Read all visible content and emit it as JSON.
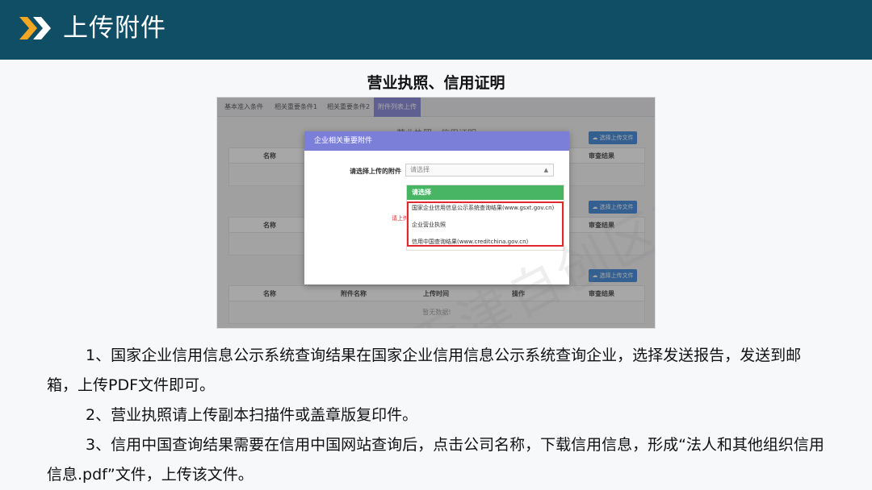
{
  "header": {
    "title": "上传附件"
  },
  "section_heading": "营业执照、信用证明",
  "screenshot": {
    "tabs": [
      {
        "label": "基本准入条件",
        "active": false
      },
      {
        "label": "相关重要条件1",
        "active": false
      },
      {
        "label": "相关重要条件2",
        "active": false
      },
      {
        "label": "附件列表上传",
        "active": true
      }
    ],
    "bg_title": "营业执照、信用证明",
    "upload_button_label": "选择上传文件",
    "columns": [
      "名称",
      "附件名称",
      "上传时间",
      "操作",
      "审查结果"
    ],
    "empty_text": "暂无数据!",
    "modal": {
      "title": "企业相关重要附件",
      "field_label": "请选择上传的附件",
      "select_placeholder": "请选择",
      "error_text": "请上传",
      "dropdown_header": "请选择",
      "options": [
        "国家企业信用信息公示系统查询结果(www.gsxt.gov.cn)",
        "企业营业执照",
        "信用中国查询结果(www.creditchina.gov.cn)"
      ]
    },
    "watermark": "天津自创区高企服务中心"
  },
  "paragraphs": [
    "1、国家企业信用信息公示系统查询结果在国家企业信用信息公示系统查询企业，选择发送报告，发送到邮箱，上传PDF文件即可。",
    "2、营业执照请上传副本扫描件或盖章版复印件。",
    "3、信用中国查询结果需要在信用中国网站查询后，点击公司名称，下载信用信息，形成“法人和其他组织信用信息.pdf”文件，上传该文件。"
  ],
  "colors": {
    "header_bg": "#0f4e64",
    "chevron": "#f5a623",
    "modal_header": "#7c7fd8",
    "dropdown_header": "#47b563",
    "highlight": "#e0282e",
    "upload_button": "#2d7fd6"
  }
}
